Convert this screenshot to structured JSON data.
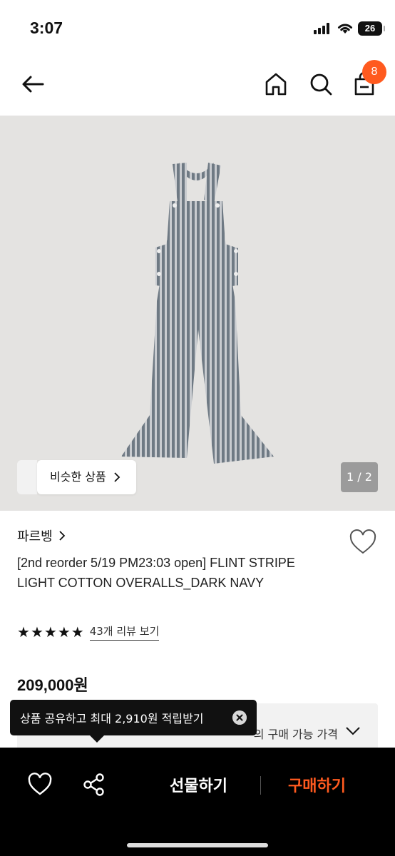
{
  "status_bar": {
    "time": "3:07",
    "battery": "26"
  },
  "nav": {
    "cart_count": "8"
  },
  "hero": {
    "similar_label": "비슷한 상품",
    "pager": "1 / 2"
  },
  "product": {
    "brand": "파르벵",
    "title": "[2nd reorder 5/19 PM23:03 open] FLINT STRIPE LIGHT COTTON OVERALLS_DARK NAVY",
    "rating_stars": 5,
    "review_link": "43개 리뷰 보기",
    "price": "209,000원"
  },
  "pricebox": {
    "label": "의 구매 가능 가격"
  },
  "tooltip": {
    "text": "상품 공유하고 최대 2,910원 적립받기"
  },
  "bottom_bar": {
    "gift_label": "선물하기",
    "buy_label": "구매하기"
  },
  "colors": {
    "accent": "#ff5a1f",
    "bar": "#000000",
    "image_bg": "#e4e3e1"
  },
  "icons": [
    "back-arrow-icon",
    "home-icon",
    "search-icon",
    "shopping-bag-icon",
    "heart-icon",
    "share-icon",
    "chevron-down-icon",
    "close-icon",
    "star-icon"
  ]
}
